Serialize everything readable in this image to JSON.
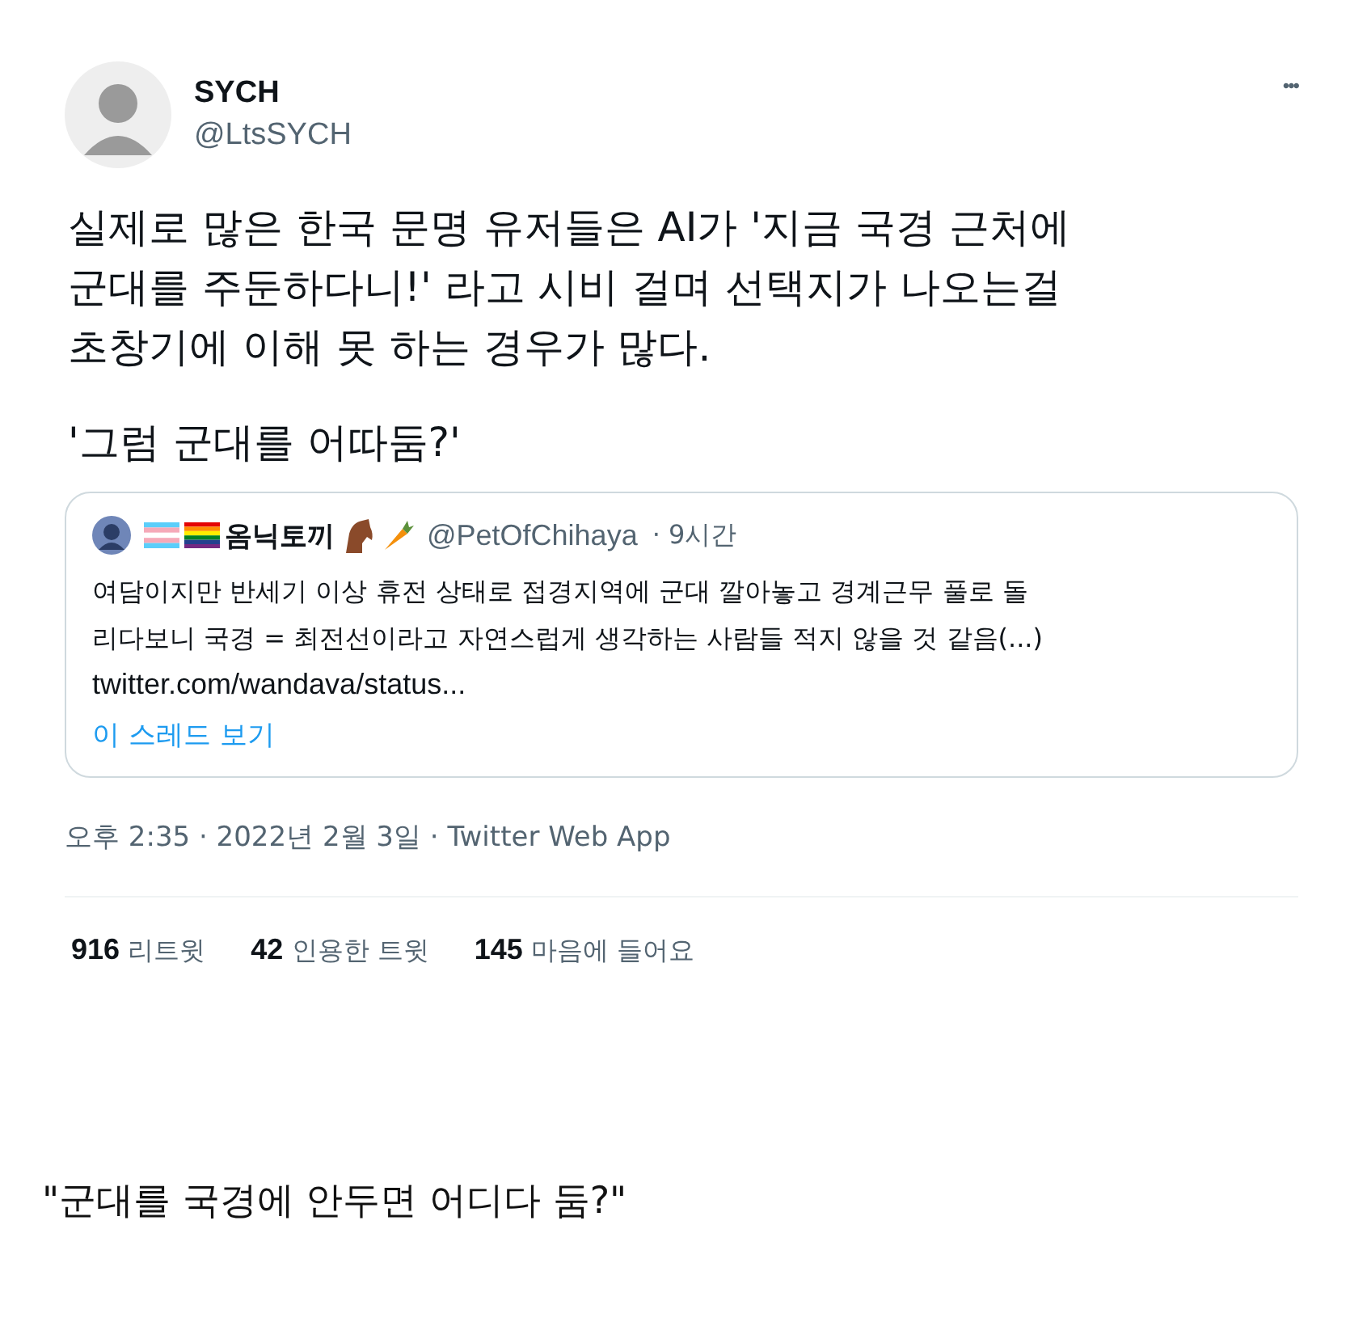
{
  "tweet": {
    "author": {
      "name": "SYCH",
      "handle": "@LtsSYCH"
    },
    "more": "•••",
    "body": [
      "실제로 많은 한국 문명 유저들은 AI가 '지금 국경 근처에\n군대를 주둔하다니!' 라고 시비 걸며 선택지가 나오는걸\n초창기에 이해 못 하는 경우가 많다.",
      "'그럼 군대를 어따둠?'"
    ],
    "quote": {
      "name": "옴닉토끼",
      "handle": "@PetOfChihaya",
      "time": "· 9시간",
      "text": "여담이지만 반세기 이상 휴전 상태로 접경지역에 군대 깔아놓고 경계근무 풀로 돌\n리다보니 국경 = 최전선이라고 자연스럽게 생각하는 사람들 적지 않을 것 같음(...)",
      "link": "twitter.com/wandava/status...",
      "thread": "이 스레드 보기"
    },
    "meta": "오후 2:35 · 2022년 2월 3일 · Twitter Web App",
    "stats": [
      {
        "count": "916",
        "label": "리트윗"
      },
      {
        "count": "42",
        "label": "인용한 트윗"
      },
      {
        "count": "145",
        "label": "마음에 들어요"
      }
    ]
  },
  "caption": "\"군대를 국경에 안두면 어디다 둠?\""
}
